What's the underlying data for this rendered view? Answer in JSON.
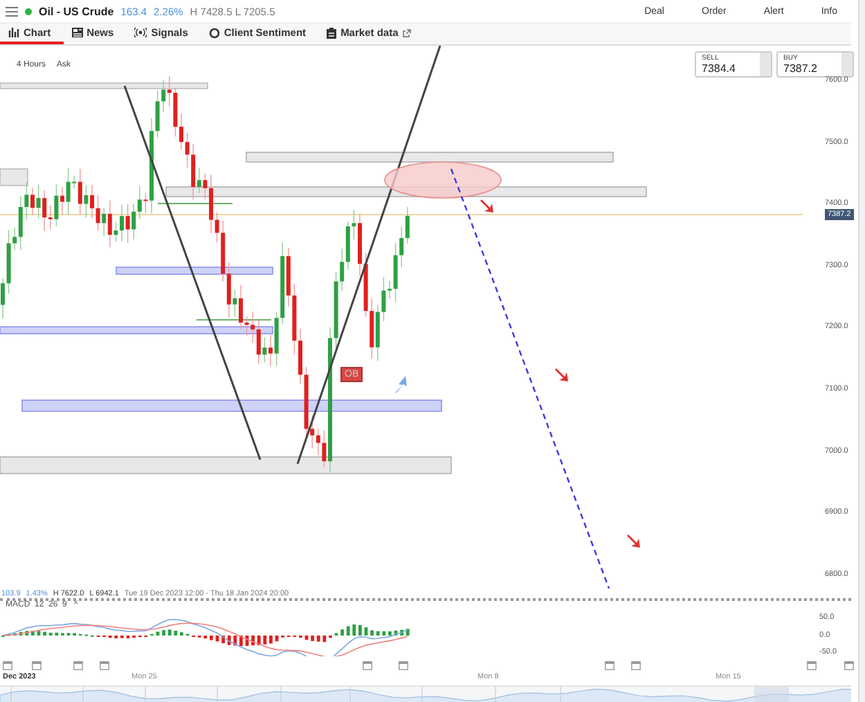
{
  "header": {
    "instrument": "Oil - US Crude",
    "change": "163.4",
    "change_pct": "2.26%",
    "high_low": "H 7428.5 L 7205.5"
  },
  "actions": [
    "Deal",
    "Order",
    "Alert",
    "Info"
  ],
  "tabs": [
    {
      "label": "Chart",
      "kind": "chart",
      "selected": true
    },
    {
      "label": "News",
      "kind": "news",
      "selected": false
    },
    {
      "label": "Signals",
      "kind": "signals",
      "selected": false
    },
    {
      "label": "Client Sentiment",
      "kind": "sentiment",
      "selected": false
    },
    {
      "label": "Market data",
      "kind": "market",
      "selected": false
    }
  ],
  "chart": {
    "timeframe": "4 Hours",
    "price_type": "Ask",
    "sell": {
      "label": "SELL",
      "value": "7384.4"
    },
    "buy": {
      "label": "BUY",
      "value": "7387.2"
    },
    "y_labels": [
      "7600.0",
      "7500.0",
      "7400.0",
      "7300.0",
      "7200.0",
      "7100.0",
      "7000.0",
      "6900.0",
      "6800.0"
    ],
    "current_price": "7387.2",
    "marker": "OB"
  },
  "range": {
    "change": "103.9",
    "change_pct": "1.43%",
    "high": "H 7622.0",
    "low": "L 6942.1",
    "period": "Tue 19 Dec 2023 12:00 - Thu 18 Jan 2024 20:00"
  },
  "macd": {
    "title": "MACD  12  26  9",
    "close": "×",
    "y_labels": [
      "50.0",
      "0.0",
      "-50.0"
    ]
  },
  "x_labels": [
    "Dec 2023",
    "Mon 25",
    "Mon 8",
    "Mon 15"
  ]
}
